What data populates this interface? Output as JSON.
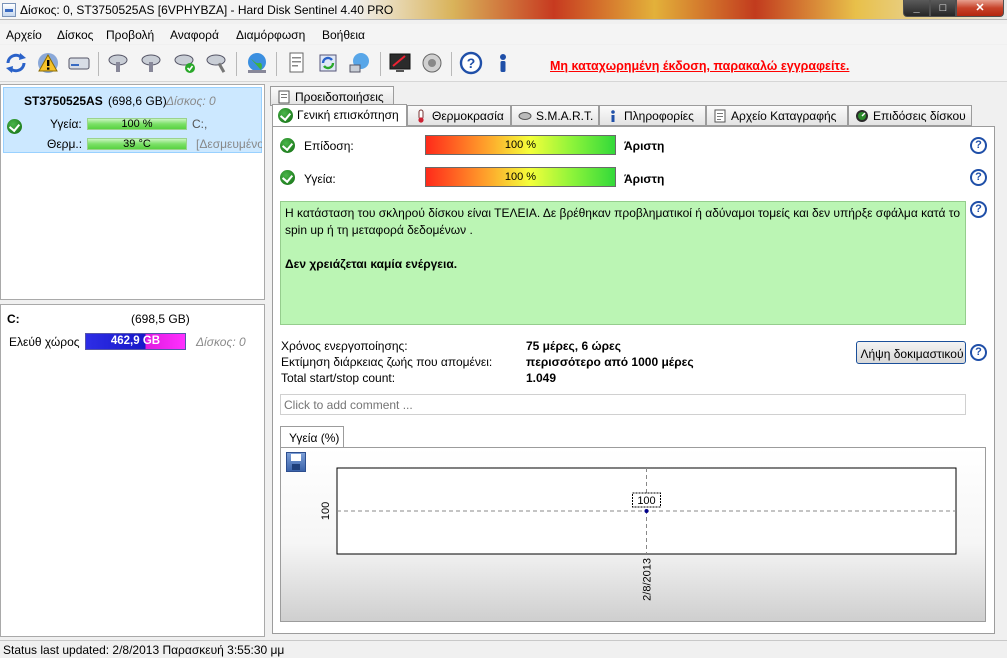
{
  "window": {
    "title": "Δίσκος: 0, ST3750525AS [6VPHYBZA]  -  Hard Disk Sentinel 4.40 PRO"
  },
  "menu": {
    "items": [
      "Αρχείο",
      "Δίσκος",
      "Προβολή",
      "Αναφορά",
      "Διαμόρφωση",
      "Βοήθεια"
    ]
  },
  "toolbar": {
    "icons": [
      "refresh-icon",
      "warning-icon",
      "drive-icon",
      "disk-test-icon",
      "disk-check-icon",
      "disk-ok-icon",
      "disk-repair-icon",
      "globe-icon",
      "report-icon",
      "sync-icon",
      "network-icon",
      "monitor-icon",
      "sound-icon",
      "help-icon",
      "info-icon"
    ],
    "register_text": "Μη καταχωρημένη έκδοση, παρακαλώ εγγραφείτε."
  },
  "disk": {
    "name": "ST3750525AS",
    "size": "(698,6 GB)",
    "disk_label": "Δίσκος: 0",
    "health_label": "Υγεία:",
    "health_value": "100 %",
    "health_fraction": 1.0,
    "drive_letter": "C:,",
    "temp_label": "Θερμ.:",
    "temp_value": "39 °C",
    "temp_fraction": 1.0,
    "reserved": "[Δεσμευμένο"
  },
  "volume": {
    "letter": "C:",
    "size": "(698,5 GB)",
    "free_label": "Ελεύθ χώρος",
    "free_value": "462,9 GB",
    "disk_label": "Δίσκος: 0"
  },
  "tabs": {
    "top": "Προειδοποιήσεις",
    "row": [
      "Γενική επισκόπηση",
      "Θερμοκρασία",
      "S.M.A.R.T.",
      "Πληροφορίες",
      "Αρχείο Καταγραφής",
      "Επιδόσεις δίσκου"
    ]
  },
  "overview": {
    "performance_label": "Επίδοση:",
    "performance_value": "100 %",
    "performance_rating": "Άριστη",
    "health_label": "Υγεία:",
    "health_value": "100 %",
    "health_rating": "Άριστη",
    "status_text": "Η κατάσταση του σκληρού δίσκου είναι ΤΕΛΕΙΑ. Δε βρέθηκαν προβληματικοί ή αδύναμοι τομείς και δεν υπήρξε σφάλμα κατά το spin up ή τη μεταφορά δεδομένων .",
    "action_text": "Δεν χρειάζεται καμία ενέργεια.",
    "power_on_label": "Χρόνος ενεργοποίησης:",
    "power_on_value": "75 μέρες, 6 ώρες",
    "lifetime_label": "Εκτίμηση διάρκειας ζωής που απομένει:",
    "lifetime_value": "περισσότερο από 1000 μέρες",
    "startstop_label": "Total start/stop count:",
    "startstop_value": "1.049",
    "test_button": "Λήψη δοκιμαστικού",
    "comment_placeholder": "Click to add comment ..."
  },
  "chart_tab": "Υγεία (%)",
  "chart_data": {
    "type": "line",
    "x": [
      "2/8/2013"
    ],
    "series": [
      {
        "values": [
          100
        ]
      }
    ],
    "ytick": "100",
    "data_label": "100",
    "grid": true
  },
  "status": {
    "text": "Status last updated: 2/8/2013 Παρασκευή 3:55:30 μμ"
  }
}
